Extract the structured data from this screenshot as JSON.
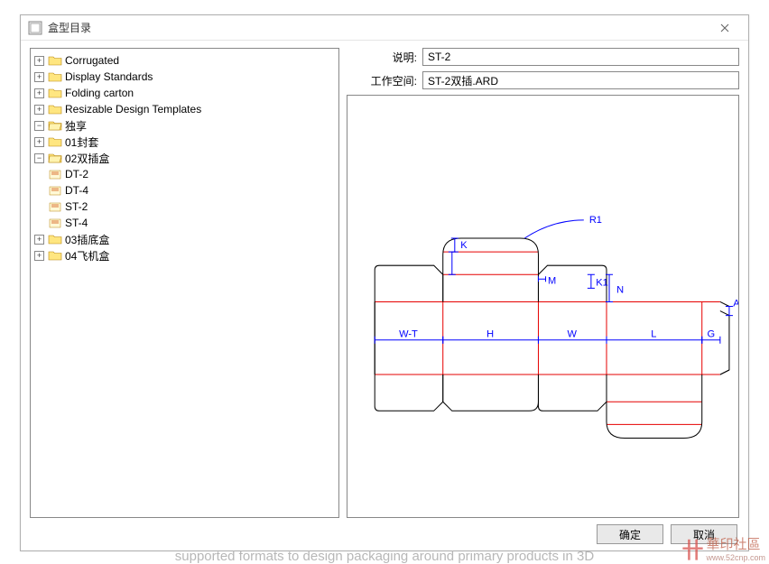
{
  "window": {
    "title": "盒型目录"
  },
  "tree": {
    "items": [
      {
        "label": "Corrugated",
        "expanded": false,
        "icon": "folder"
      },
      {
        "label": "Display Standards",
        "expanded": false,
        "icon": "folder"
      },
      {
        "label": "Folding carton",
        "expanded": false,
        "icon": "folder"
      },
      {
        "label": "Resizable Design Templates",
        "expanded": false,
        "icon": "folder"
      },
      {
        "label": "独享",
        "expanded": true,
        "icon": "folder",
        "children": [
          {
            "label": "01封套",
            "expanded": false,
            "icon": "folder"
          },
          {
            "label": "02双插盒",
            "expanded": true,
            "icon": "folder",
            "children": [
              {
                "label": "DT-2",
                "icon": "box"
              },
              {
                "label": "DT-4",
                "icon": "box"
              },
              {
                "label": "ST-2",
                "icon": "box"
              },
              {
                "label": "ST-4",
                "icon": "box"
              }
            ]
          },
          {
            "label": "03插底盒",
            "expanded": false,
            "icon": "folder"
          },
          {
            "label": "04飞机盒",
            "expanded": false,
            "icon": "folder"
          }
        ]
      }
    ]
  },
  "fields": {
    "desc_label": "说明:",
    "desc_value": "ST-2",
    "workspace_label": "工作空间:",
    "workspace_value": "ST-2双插.ARD"
  },
  "preview": {
    "labels": {
      "R1": "R1",
      "K": "K",
      "M": "M",
      "K1": "K1",
      "N": "N",
      "A": "A",
      "WT": "W-T",
      "H": "H",
      "W": "W",
      "L": "L",
      "G": "G"
    },
    "colors": {
      "cut": "#000000",
      "crease": "#e60000",
      "dimension": "#0000ff"
    }
  },
  "buttons": {
    "ok": "确定",
    "cancel": "取消"
  },
  "watermark": {
    "text": "華印社區",
    "sub": "www.52cnp.com"
  },
  "footer": "supported formats to design packaging around primary products in 3D"
}
